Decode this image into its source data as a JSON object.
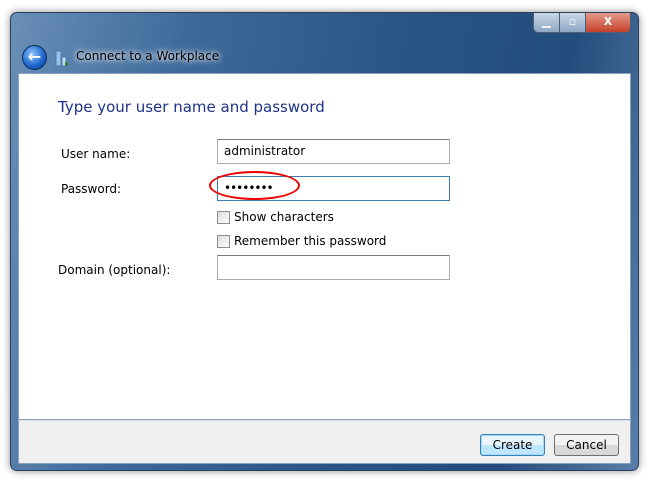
{
  "window": {
    "title": "Connect to a Workplace",
    "minimize": "▁",
    "maximize": "▫",
    "close": "X"
  },
  "heading": "Type your user name and password",
  "fields": {
    "username": {
      "label": "User name:",
      "value": "administrator"
    },
    "password": {
      "label": "Password:",
      "value": "••••••••"
    },
    "domain": {
      "label": "Domain (optional):",
      "value": ""
    }
  },
  "checkboxes": {
    "show": "Show characters",
    "remember": "Remember this password"
  },
  "buttons": {
    "create": "Create",
    "cancel": "Cancel"
  }
}
